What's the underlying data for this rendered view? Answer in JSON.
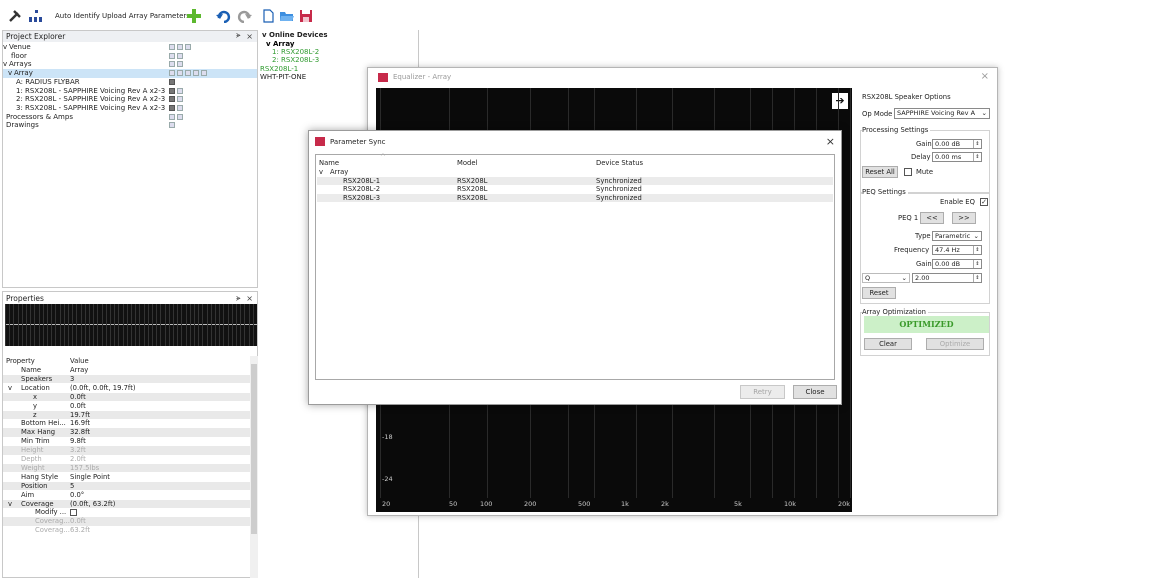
{
  "toolbar": {
    "auto_identify": "Auto Identify",
    "upload_array_parameters": "Upload Array Parameters"
  },
  "project_explorer": {
    "title": "Project Explorer",
    "items": [
      {
        "label": "Venue",
        "indent": 0,
        "caret": "v"
      },
      {
        "label": "floor",
        "indent": 1,
        "caret": ""
      },
      {
        "label": "Arrays",
        "indent": 0,
        "caret": "v"
      },
      {
        "label": "Array",
        "indent": 1,
        "caret": "v"
      },
      {
        "label": "A: RADIUS FLYBAR",
        "indent": 2,
        "caret": ""
      },
      {
        "label": "1: RSX208L - SAPPHIRE Voicing Rev A x2-3",
        "indent": 2,
        "caret": ""
      },
      {
        "label": "2: RSX208L - SAPPHIRE Voicing Rev A x2-3",
        "indent": 2,
        "caret": ""
      },
      {
        "label": "3: RSX208L - SAPPHIRE Voicing Rev A x2-3",
        "indent": 2,
        "caret": ""
      },
      {
        "label": "Processors & Amps",
        "indent": 0,
        "caret": ""
      },
      {
        "label": "Drawings",
        "indent": 0,
        "caret": ""
      }
    ]
  },
  "properties": {
    "title": "Properties",
    "col_property": "Property",
    "col_value": "Value",
    "rows": [
      {
        "k": "Name",
        "v": "Array",
        "caret": "",
        "dim": false
      },
      {
        "k": "Speakers",
        "v": "3",
        "caret": "",
        "dim": false
      },
      {
        "k": "Location",
        "v": "(0.0ft, 0.0ft, 19.7ft)",
        "caret": "v",
        "dim": false
      },
      {
        "k": "x",
        "v": "0.0ft",
        "caret": "",
        "dim": false
      },
      {
        "k": "y",
        "v": "0.0ft",
        "caret": "",
        "dim": false
      },
      {
        "k": "z",
        "v": "19.7ft",
        "caret": "",
        "dim": false
      },
      {
        "k": "Bottom Hei...",
        "v": "16.9ft",
        "caret": "",
        "dim": false
      },
      {
        "k": "Max Hang",
        "v": "32.8ft",
        "caret": "",
        "dim": false
      },
      {
        "k": "Min Trim",
        "v": "9.8ft",
        "caret": "",
        "dim": false
      },
      {
        "k": "Height",
        "v": "3.2ft",
        "caret": "",
        "dim": true
      },
      {
        "k": "Depth",
        "v": "2.0ft",
        "caret": "",
        "dim": true
      },
      {
        "k": "Weight",
        "v": "157.5lbs",
        "caret": "",
        "dim": true
      },
      {
        "k": "Hang Style",
        "v": "Single Point",
        "caret": "",
        "dim": false
      },
      {
        "k": "Position",
        "v": "5",
        "caret": "",
        "dim": false
      },
      {
        "k": "Aim",
        "v": "0.0°",
        "caret": "",
        "dim": false
      },
      {
        "k": "Coverage",
        "v": "(0.0ft, 63.2ft)",
        "caret": "v",
        "dim": false
      },
      {
        "k": "Modify ...",
        "v": "",
        "caret": "",
        "dim": false
      },
      {
        "k": "Coverag...",
        "v": "0.0ft",
        "caret": "",
        "dim": true
      },
      {
        "k": "Coverag...",
        "v": "63.2ft",
        "caret": "",
        "dim": true
      }
    ]
  },
  "online_devices": {
    "title": "Online Devices",
    "items": [
      {
        "label": "Array",
        "color": "#000000",
        "bold": true
      },
      {
        "label": "1: RSX208L-2",
        "color": "#2e9a2e",
        "bold": false
      },
      {
        "label": "2: RSX208L-3",
        "color": "#2e9a2e",
        "bold": false
      },
      {
        "label": "RSX208L-1",
        "color": "#2e9a2e",
        "bold": false
      },
      {
        "label": "WHT-PIT-ONE",
        "color": "#222222",
        "bold": false
      }
    ]
  },
  "equalizer": {
    "title": "Equalizer - Array",
    "y_labels": [
      "-18",
      "-24"
    ],
    "x_labels": [
      "20",
      "50",
      "100",
      "200",
      "500",
      "1k",
      "2k",
      "5k",
      "10k",
      "20k"
    ],
    "options": {
      "speaker_options_title": "RSX208L Speaker Options",
      "op_mode_label": "Op Mode",
      "op_mode_value": "SAPPHIRE Voicing Rev A",
      "processing_title": "Processing Settings",
      "gain_label": "Gain",
      "gain_value": "0.00 dB",
      "delay_label": "Delay",
      "delay_value": "0.00 ms",
      "reset_all": "Reset All",
      "mute_label": "Mute",
      "peq_title": "PEQ Settings",
      "enable_eq": "Enable EQ",
      "peq_label": "PEQ 1",
      "prev": "<<",
      "next": ">>",
      "type_label": "Type",
      "type_value": "Parametric",
      "frequency_label": "Frequency",
      "frequency_value": "47.4 Hz",
      "peq_gain_label": "Gain",
      "peq_gain_value": "0.00 dB",
      "q_label": "Q",
      "q_value": "2.00",
      "reset": "Reset",
      "array_opt_title": "Array Optimization",
      "optimized": "OPTIMIZED",
      "clear": "Clear",
      "optimize": "Optimize"
    }
  },
  "parameter_sync": {
    "title": "Parameter Sync",
    "col_name": "Name",
    "col_model": "Model",
    "col_status": "Device Status",
    "group": "Array",
    "rows": [
      {
        "name": "RSX208L-1",
        "model": "RSX208L",
        "status": "Synchronized"
      },
      {
        "name": "RSX208L-2",
        "model": "RSX208L",
        "status": "Synchronized"
      },
      {
        "name": "RSX208L-3",
        "model": "RSX208L",
        "status": "Synchronized"
      }
    ],
    "retry": "Retry",
    "close": "Close"
  },
  "colors": {
    "accent_green": "#2e9a2e",
    "optimized_bg": "#ccf0c8",
    "selection": "#cce4f7"
  }
}
